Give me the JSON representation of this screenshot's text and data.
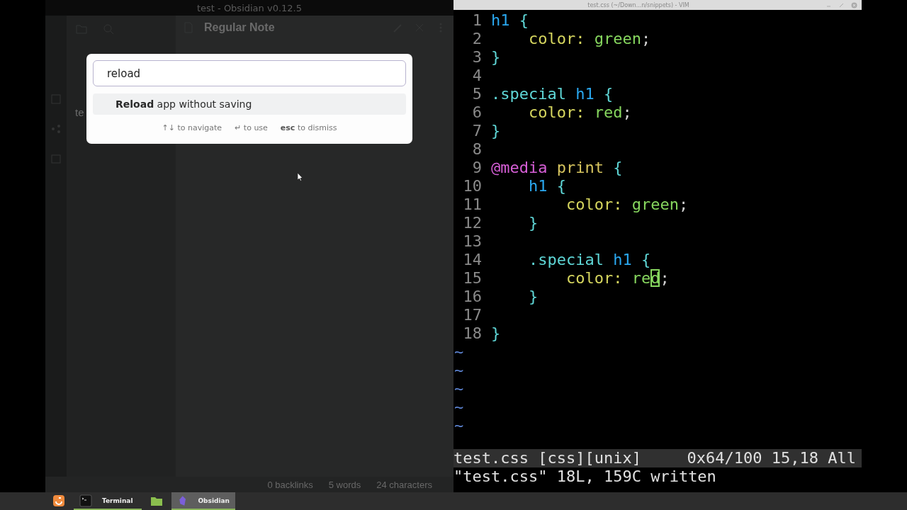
{
  "obsidian": {
    "window_title": "test - Obsidian v0.12.5",
    "note_title": "Regular Note",
    "file_item": "te",
    "status_bar": [
      "0 backlinks",
      "5 words",
      "24 characters"
    ],
    "command_palette": {
      "query": "reload",
      "results": [
        {
          "label": "**Reload** app without saving",
          "selected": true
        }
      ],
      "instructions": [
        "↑↓ to navigate",
        "↵ to use",
        "**esc** to dismiss"
      ]
    }
  },
  "vim": {
    "window_title": "test.css (~/Down...n/snippets) - VIM",
    "lines": [
      {
        "number": "1",
        "tokens": [
          {
            "kind": "tag",
            "text": "h1"
          },
          {
            "kind": "brace",
            "text": " {"
          }
        ]
      },
      {
        "number": "2",
        "tokens": [
          {
            "kind": "prop",
            "text": "    color:"
          },
          {
            "kind": "value",
            "text": " green"
          },
          {
            "kind": "plain",
            "text": ";"
          }
        ]
      },
      {
        "number": "3",
        "tokens": [
          {
            "kind": "brace",
            "text": "}"
          }
        ]
      },
      {
        "number": "4"
      },
      {
        "number": "5",
        "tokens": [
          {
            "kind": "class",
            "text": ".special"
          },
          {
            "kind": "tag",
            "text": " h1"
          },
          {
            "kind": "brace",
            "text": " {"
          }
        ]
      },
      {
        "number": "6",
        "tokens": [
          {
            "kind": "prop",
            "text": "    color:"
          },
          {
            "kind": "value",
            "text": " red"
          },
          {
            "kind": "plain",
            "text": ";"
          }
        ]
      },
      {
        "number": "7",
        "tokens": [
          {
            "kind": "brace",
            "text": "}"
          }
        ]
      },
      {
        "number": "8"
      },
      {
        "number": "9",
        "tokens": [
          {
            "kind": "at",
            "text": "@media"
          },
          {
            "kind": "media",
            "text": " print"
          },
          {
            "kind": "brace",
            "text": " {"
          }
        ]
      },
      {
        "number": "10",
        "tokens": [
          {
            "kind": "tag",
            "text": "    h1"
          },
          {
            "kind": "brace",
            "text": " {"
          }
        ]
      },
      {
        "number": "11",
        "tokens": [
          {
            "kind": "prop",
            "text": "        color:"
          },
          {
            "kind": "value",
            "text": " green"
          },
          {
            "kind": "plain",
            "text": ";"
          }
        ]
      },
      {
        "number": "12",
        "tokens": [
          {
            "kind": "brace",
            "text": "    }"
          }
        ]
      },
      {
        "number": "13"
      },
      {
        "number": "14",
        "tokens": [
          {
            "kind": "class",
            "text": "    .special"
          },
          {
            "kind": "tag",
            "text": " h1"
          },
          {
            "kind": "brace",
            "text": " {"
          }
        ]
      },
      {
        "number": "15",
        "tokens": [
          {
            "kind": "prop",
            "text": "        color:"
          },
          {
            "kind": "value",
            "text": " re"
          },
          {
            "kind": "value",
            "text": "d",
            "cursor": true
          },
          {
            "kind": "plain",
            "text": ";"
          }
        ]
      },
      {
        "number": "16",
        "tokens": [
          {
            "kind": "brace",
            "text": "    }"
          }
        ]
      },
      {
        "number": "17"
      },
      {
        "number": "18",
        "tokens": [
          {
            "kind": "brace",
            "text": "}"
          }
        ]
      }
    ],
    "empty_lines": [
      "~",
      "~",
      "~",
      "~",
      "~"
    ],
    "status_line": {
      "left": "test.css [css][unix]",
      "right": "0x64/100 15,18 All"
    },
    "message": "\"test.css\" 18L, 159C written"
  },
  "taskbar": {
    "items": [
      {
        "kind": "menu",
        "selected": false
      },
      {
        "kind": "terminal",
        "label": "Terminal",
        "selected": false
      },
      {
        "kind": "files",
        "selected": false
      },
      {
        "kind": "obsidian",
        "label": "Obsidian",
        "selected": true
      }
    ]
  }
}
